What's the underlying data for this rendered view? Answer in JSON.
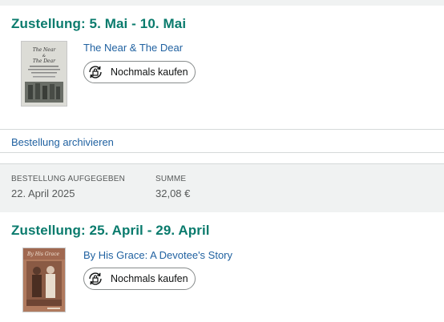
{
  "orders": [
    {
      "delivery_title": "Zustellung: 5. Mai - 10. Mai",
      "item_title": "The Near & The Dear",
      "buy_again_label": "Nochmals kaufen",
      "cover_text": "The Near & The Dear"
    },
    {
      "delivery_title": "Zustellung: 25. April - 29. April",
      "item_title": "By His Grace: A Devotee's Story",
      "buy_again_label": "Nochmals kaufen",
      "cover_text": "By His Grace"
    }
  ],
  "archive_link": "Bestellung archivieren",
  "summary": {
    "placed_label": "BESTELLUNG AUFGEGEBEN",
    "placed_value": "22. April 2025",
    "total_label": "SUMME",
    "total_value": "32,08 €"
  },
  "colors": {
    "delivery_green": "#0a7b6d",
    "link_blue": "#2162a1",
    "summary_bg": "#f0f2f2"
  }
}
